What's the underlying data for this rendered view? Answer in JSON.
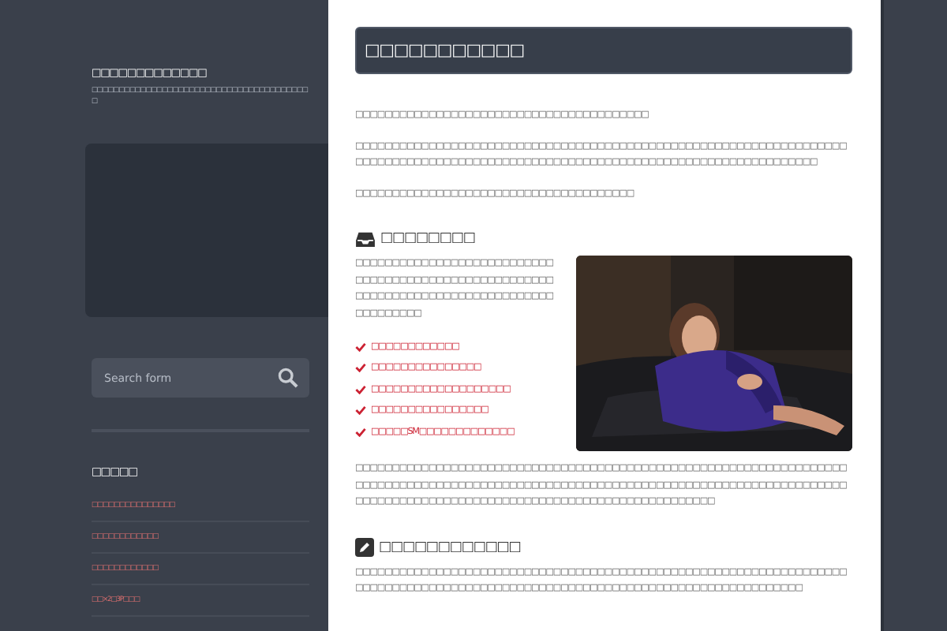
{
  "site": {
    "title": "□□□□□□□□□□□□□",
    "tagline": "□□□□□□□□□□□□□□□□□□□□□□□□□□□□□□□□□□□□□□□□□"
  },
  "search": {
    "placeholder": "Search form"
  },
  "sidebar": {
    "heading": "□□□□□",
    "links": [
      "□□□□□□□□□□□□□□□",
      "□□□□□□□□□□□□",
      "□□□□□□□□□□□□",
      "□□×2□3P□□□"
    ]
  },
  "article": {
    "title": "□□□□□□□□□□□",
    "intro": [
      "□□□□□□□□□□□□□□□□□□□□□□□□□□□□□□□□□□□□□□□□",
      "□□□□□□□□□□□□□□□□□□□□□□□□□□□□□□□□□□□□□□□□□□□□□□□□□□□□□□□□□□□□□□□□□□□□□□□□□□□□□□□□□□□□□□□□□□□□□□□□□□□□□□□□□□□□□□□□□□□□□□□□□□□□□□□□□□",
      "□□□□□□□□□□□□□□□□□□□□□□□□□□□□□□□□□□□□□□"
    ],
    "sections": [
      {
        "heading": "□□□□□□□□",
        "text": "□□□□□□□□□□□□□□□□□□□□□□□□□□□□□□□□□□□□□□□□□□□□□□□□□□□□□□□□□□□□□□□□□□□□□□□□□□□□□□□□□□□□□□□□□□",
        "checklist": [
          "□□□□□□□□□□□□",
          "□□□□□□□□□□□□□□□",
          "□□□□□□□□□□□□□□□□□□□",
          "□□□□□□□□□□□□□□□□",
          "□□□□□SM□□□□□□□□□□□□□"
        ],
        "after": "□□□□□□□□□□□□□**□□□□□□□□□□□□□□□□□□□□□□□□□□**□□□□□□□□□□□□□□□□□□□□□□□□□□□□□□□□□□□□□□□□□□□□□□□□□□□□□□□□□□□□□□□□□□□□□□□□□□□□□□□□□□□□□□□□□□□□□□□□□□□□□□□□□□□□□□□□□□□□□□□□□□□□□□□□□□□□□□□□□□□□□□□□"
      },
      {
        "heading": "□□□□□□□□□□□□",
        "text": "□□□□□□□□□□□□□□□□□□□□□□□□□□□□□□□□□□□□□□□□□□□□□□□□□□□□□□□□□□□□□□□□□□□□□□□□□□□□□□□□□□□□□□□□□□□□□□□□□□□□□□□□□□□□□□□□□□□□□□□□□□□□□□□□"
      }
    ]
  }
}
